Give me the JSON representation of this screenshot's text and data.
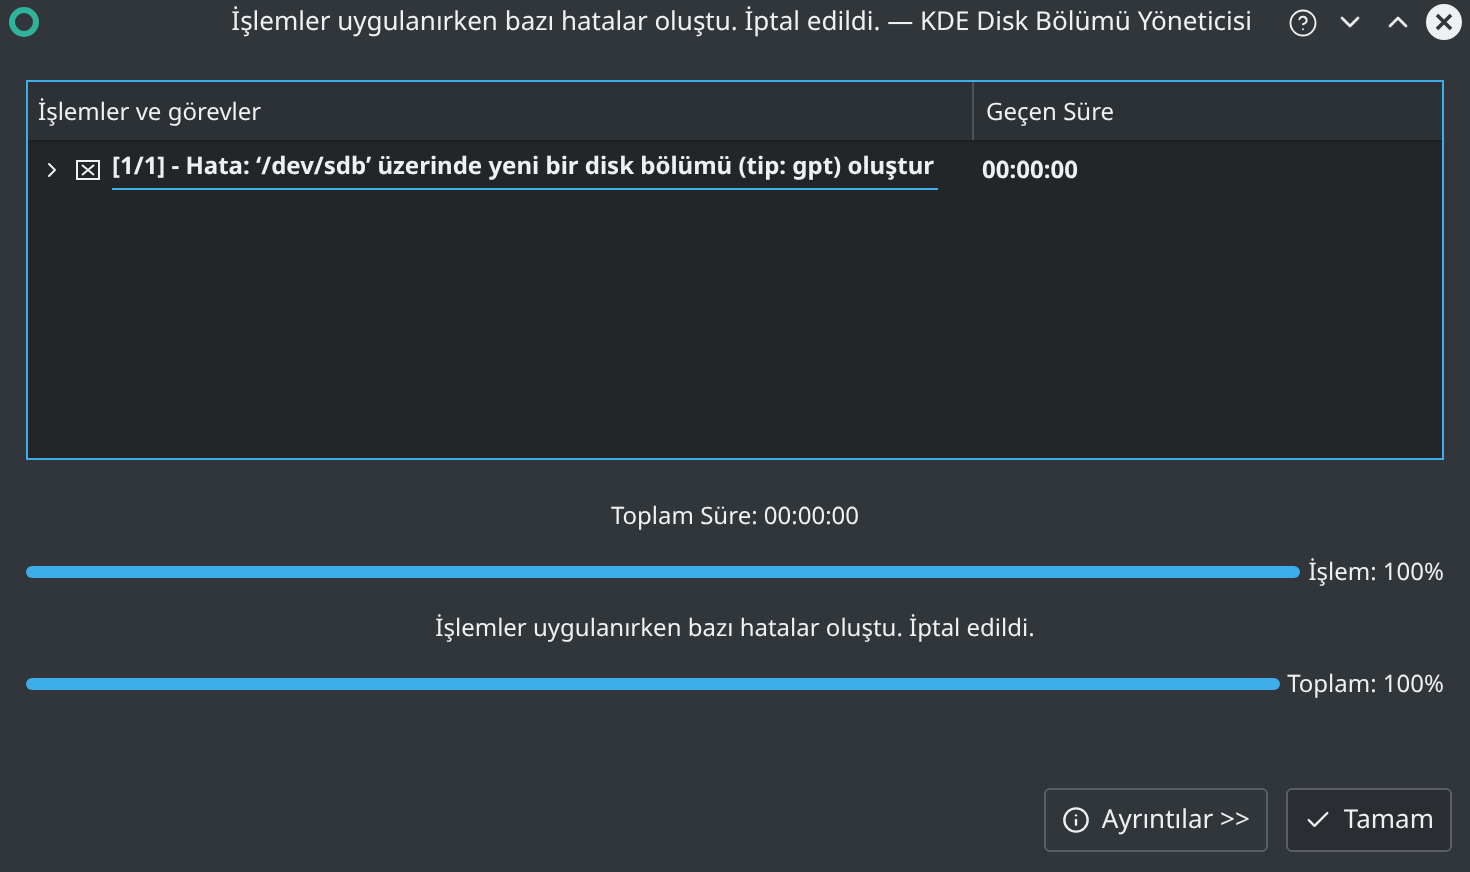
{
  "window": {
    "title": "İşlemler uygulanırken bazı hatalar oluştu. İptal edildi. — KDE Disk Bölümü Yöneticisi"
  },
  "table": {
    "columns": [
      "İşlemler ve görevler",
      "Geçen Süre"
    ],
    "rows": [
      {
        "expanded": false,
        "task": "[1/1] - Hata: ‘/dev/sdb’ üzerinde yeni bir disk bölümü (tip: gpt) oluştur",
        "elapsed": "00:00:00"
      }
    ]
  },
  "status": [
    {
      "kind": "text",
      "text": "Toplam Süre: 00:00:00"
    },
    {
      "kind": "bar",
      "level": 1,
      "label": "İşlem: 100%"
    },
    {
      "kind": "text",
      "text": "İşlemler uygulanırken bazı hatalar oluştu. İptal edildi."
    },
    {
      "kind": "bar",
      "level": 1,
      "label": "Toplam: 100%"
    }
  ],
  "buttons": [
    {
      "kind": "details",
      "label": "Ayrıntılar >>"
    },
    {
      "kind": "ok",
      "label": "Tamam"
    }
  ]
}
